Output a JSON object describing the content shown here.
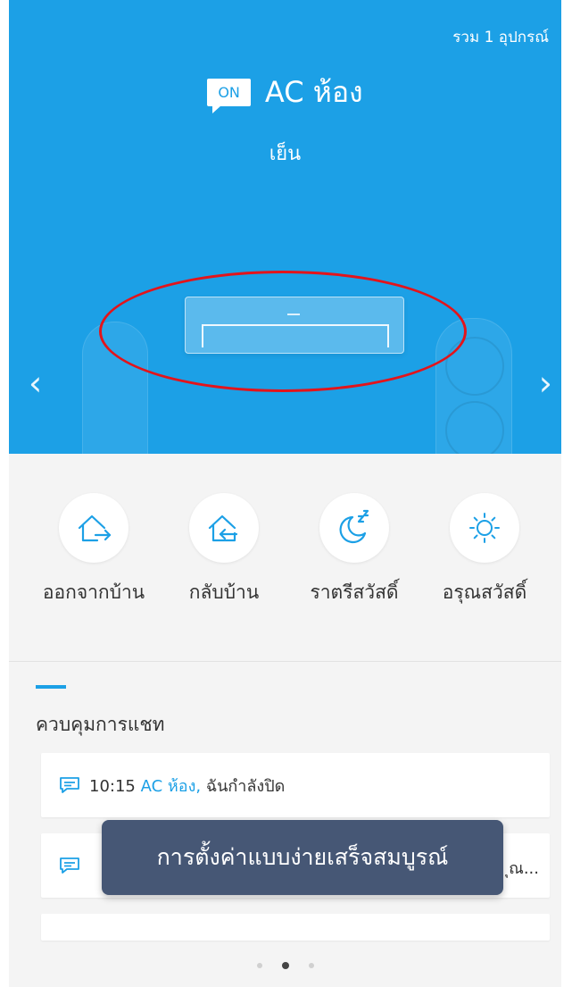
{
  "header": {
    "device_count": "รวม 1 อุปกรณ์",
    "power_badge": "ON",
    "device_name": "AC ห้อง",
    "mode_text": "เย็น"
  },
  "carousel": {
    "prev_glyph": "‹",
    "next_glyph": "›"
  },
  "quick_modes": [
    {
      "label": "ออกจากบ้าน",
      "icon": "leave-home-icon"
    },
    {
      "label": "กลับบ้าน",
      "icon": "return-home-icon"
    },
    {
      "label": "ราตรีสวัสดิ์",
      "icon": "moon-sleep-icon"
    },
    {
      "label": "อรุณสวัสดิ์",
      "icon": "sun-icon"
    }
  ],
  "chat": {
    "section_title": "ควบคุมการแชท",
    "messages": [
      {
        "time": "10:15",
        "device": "AC ห้อง,",
        "text": " ฉันกำลังปิด"
      },
      {
        "truncated_tail": "ุณ..."
      }
    ]
  },
  "toast": "การตั้งค่าแบบง่ายเสร็จสมบูรณ์",
  "pager": {
    "pages": 3,
    "active_index": 1
  },
  "colors": {
    "hero_blue": "#1ca0e6",
    "accent": "#1ca0e6",
    "toast_bg": "#465775",
    "highlight_ring": "#e3141b"
  }
}
